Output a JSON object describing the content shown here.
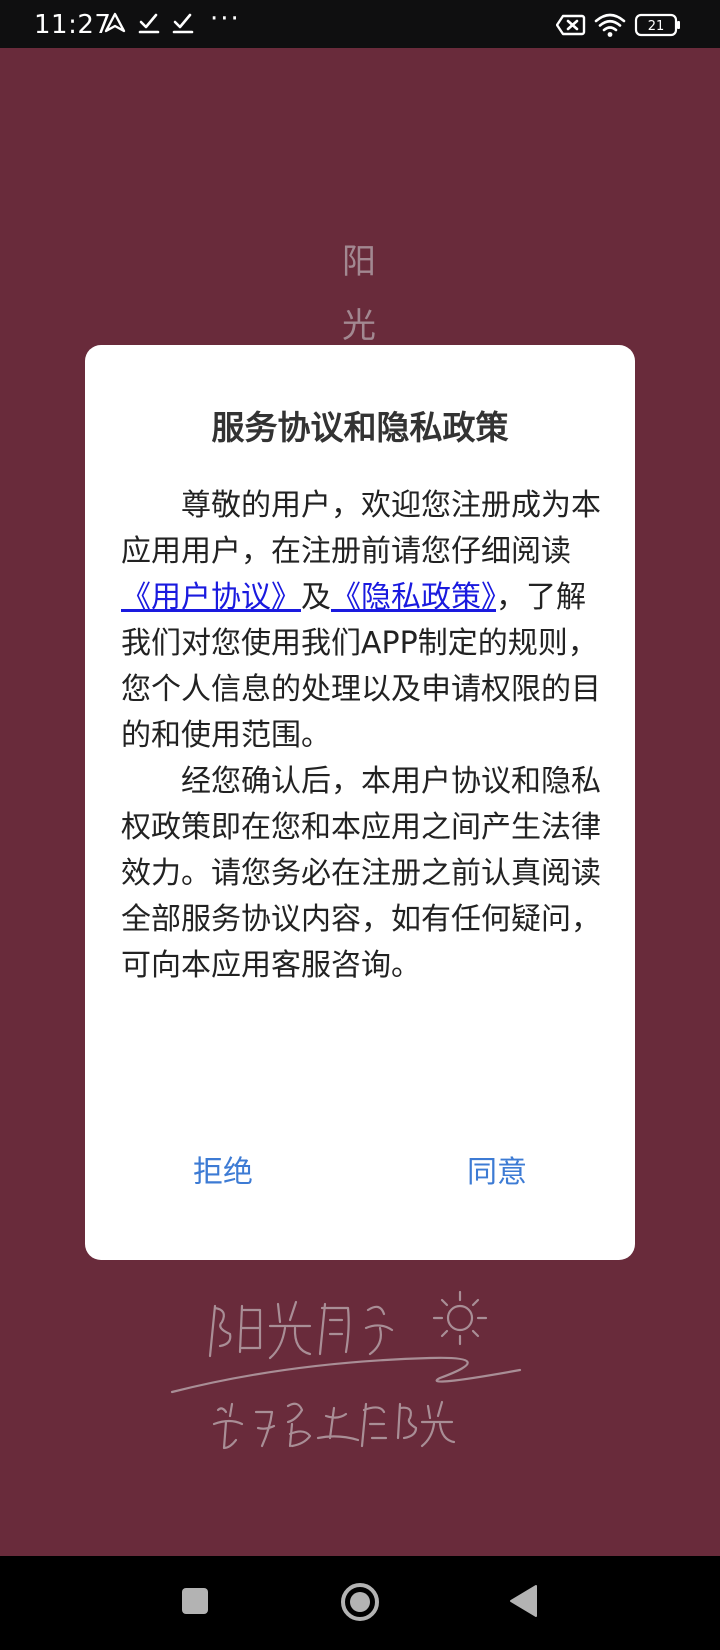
{
  "status_bar": {
    "time": "11:27",
    "more": "···",
    "battery_level": "21",
    "icons": [
      "location-arrow-icon",
      "download-check-icon",
      "download-check-icon",
      "no-sim-icon",
      "wifi-icon",
      "battery-icon"
    ]
  },
  "splash": {
    "title_chars": [
      "阳",
      "光"
    ]
  },
  "dialog": {
    "title": "服务协议和隐私政策",
    "p1_before": "尊敬的用户，欢迎您注册成为本应用用户，在注册前请您仔细阅读",
    "link_user_agreement": "《用户协议》",
    "p1_and": "及",
    "link_privacy_policy": "《隐私政策》",
    "p1_after": "，了解我们对您使用我们APP制定的规则，您个人信息的处理以及申请权限的目的和使用范围。",
    "p2": "经您确认后，本用户协议和隐私权政策即在您和本应用之间产生法律效力。请您务必在注册之前认真阅读全部服务协议内容，如有任何疑问，可向本应用客服咨询。",
    "reject_label": "拒绝",
    "agree_label": "同意"
  },
  "colors": {
    "background": "#692b3b",
    "dialog": "#ffffff",
    "button_text": "#3d7bd4",
    "link": "#1a1adf"
  }
}
